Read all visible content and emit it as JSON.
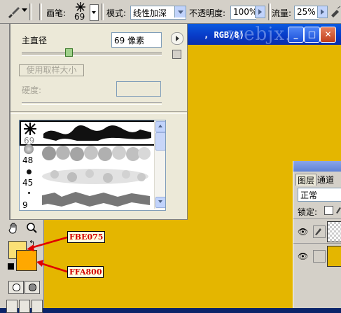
{
  "options_bar": {
    "brush_label": "画笔:",
    "brush_size": "69",
    "mode_label": "模式:",
    "mode_value": "线性加深",
    "opacity_label": "不透明度:",
    "opacity_value": "100%",
    "flow_label": "流量:",
    "flow_value": "25%"
  },
  "document": {
    "title_suffix": ", RGB/8)",
    "watermark": "webjx.com",
    "canvas_color": "#E4B600"
  },
  "brush_popup": {
    "master_diameter_label": "主直径",
    "diameter_value": "69 像素",
    "use_sample_size_label": "使用取样大小",
    "hardness_label": "硬度:",
    "brushes": [
      {
        "size": "69",
        "selected": true
      },
      {
        "size": "48",
        "selected": false
      },
      {
        "size": "45",
        "selected": false
      },
      {
        "size": "9",
        "selected": false
      }
    ]
  },
  "toolbox": {
    "foreground_color": "#FBE075",
    "background_color": "#FFA800"
  },
  "annotations": {
    "foreground_hex": "FBE075",
    "background_hex": "FFA800"
  },
  "layers_panel": {
    "tab_layers": "图层",
    "tab_channels": "通道",
    "blend_mode": "正常",
    "lock_label": "锁定:"
  }
}
